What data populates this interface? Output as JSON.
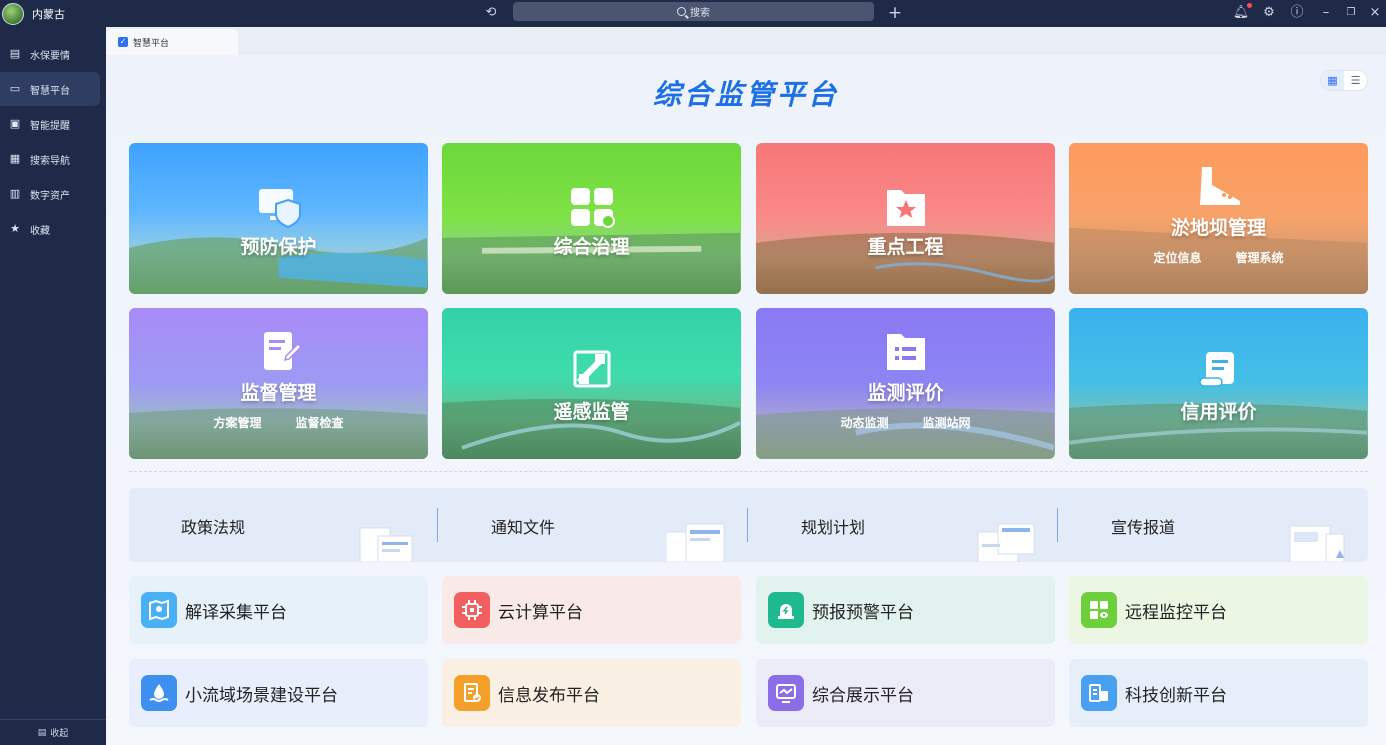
{
  "app": {
    "name": "内蒙古"
  },
  "search": {
    "placeholder": "搜索"
  },
  "sidebar": {
    "items": [
      {
        "label": "水保要情",
        "icon": "book-icon"
      },
      {
        "label": "智慧平台",
        "icon": "monitor-icon"
      },
      {
        "label": "智能提醒",
        "icon": "message-icon"
      },
      {
        "label": "搜索导航",
        "icon": "grid-search-icon"
      },
      {
        "label": "数字资产",
        "icon": "clipboard-icon"
      },
      {
        "label": "收藏",
        "icon": "star-icon"
      }
    ],
    "collapse_label": "收起"
  },
  "tab": {
    "label": "智慧平台"
  },
  "page": {
    "title": "综合监管平台"
  },
  "cards": [
    {
      "label": "预防保护",
      "subs": [],
      "icon": "shield-monitor-icon",
      "color": "#3aa0ff"
    },
    {
      "label": "综合治理",
      "subs": [],
      "icon": "blocks-icon",
      "color": "#6bd83a"
    },
    {
      "label": "重点工程",
      "subs": [],
      "icon": "star-folder-icon",
      "color": "#f77b7b"
    },
    {
      "label": "淤地坝管理",
      "subs": [
        "定位信息",
        "管理系统"
      ],
      "icon": "dam-icon",
      "color": "#ff9a5c"
    },
    {
      "label": "监督管理",
      "subs": [
        "方案管理",
        "监督检查"
      ],
      "icon": "edit-doc-icon",
      "color": "#9f86f5"
    },
    {
      "label": "遥感监管",
      "subs": [],
      "icon": "satellite-icon",
      "color": "#32d3a6"
    },
    {
      "label": "监测评价",
      "subs": [
        "动态监测",
        "监测站网"
      ],
      "icon": "list-folder-icon",
      "color": "#8b7bf2"
    },
    {
      "label": "信用评价",
      "subs": [],
      "icon": "scroll-icon",
      "color": "#3fb3ef"
    }
  ],
  "docs": [
    {
      "label": "政策法规"
    },
    {
      "label": "通知文件"
    },
    {
      "label": "规划计划"
    },
    {
      "label": "宣传报道"
    }
  ],
  "platforms": [
    {
      "label": "解译采集平台",
      "icon": "map-pin-icon",
      "color": "#4ab0f5",
      "bg": "#e7f1fa"
    },
    {
      "label": "云计算平台",
      "icon": "chip-icon",
      "color": "#f25f5f",
      "bg": "#f9e9e9"
    },
    {
      "label": "预报预警平台",
      "icon": "alarm-icon",
      "color": "#1fb990",
      "bg": "#e2f3ef"
    },
    {
      "label": "远程监控平台",
      "icon": "monitor-eye-icon",
      "color": "#6ccf3b",
      "bg": "#ebf6e3"
    },
    {
      "label": "小流域场景建设平台",
      "icon": "water-drop-icon",
      "color": "#3d8ff0",
      "bg": "#e8eefb"
    },
    {
      "label": "信息发布平台",
      "icon": "doc-check-icon",
      "color": "#f59f2b",
      "bg": "#f9efe2"
    },
    {
      "label": "综合展示平台",
      "icon": "display-icon",
      "color": "#8b6de8",
      "bg": "#ecebf8"
    },
    {
      "label": "科技创新平台",
      "icon": "lab-icon",
      "color": "#4aa0f0",
      "bg": "#e6eefa"
    }
  ]
}
